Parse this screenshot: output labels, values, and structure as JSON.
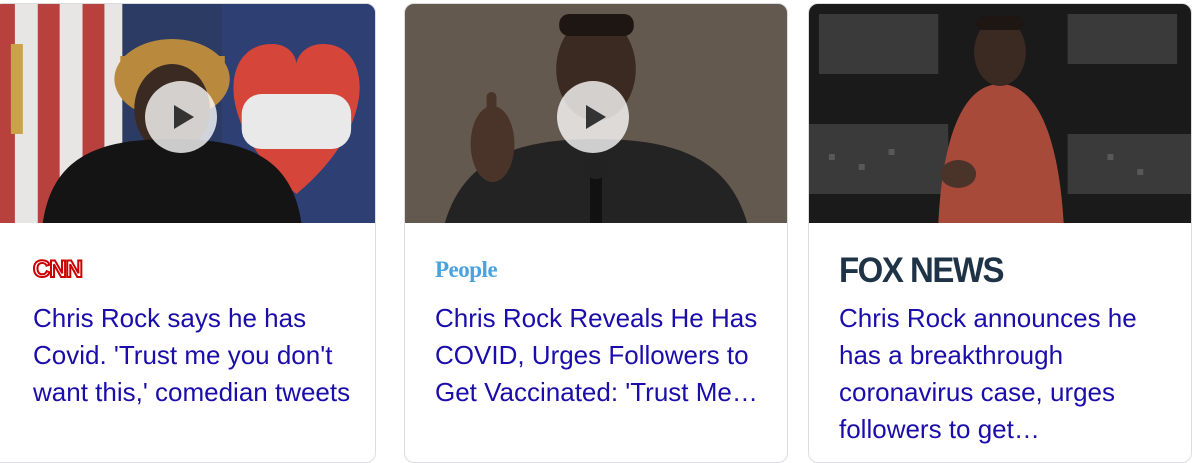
{
  "cards": [
    {
      "source": "CNN",
      "headline": "Chris Rock says he has Covid. 'Trust me you don't want this,' comedian tweets",
      "has_video": true,
      "logo_color": "#cc0000"
    },
    {
      "source": "People",
      "headline": "Chris Rock Reveals He Has COVID, Urges Followers to Get Vaccinated: 'Trust Me…",
      "has_video": true,
      "logo_color": "#4aa3df"
    },
    {
      "source": "FOX NEWS",
      "headline": "Chris Rock announces he has a breakthrough coronavirus case, urges followers to get…",
      "has_video": false,
      "logo_color": "#1f3347"
    }
  ],
  "colors": {
    "headline_link": "#1a0dab",
    "card_border": "#dadce0"
  }
}
